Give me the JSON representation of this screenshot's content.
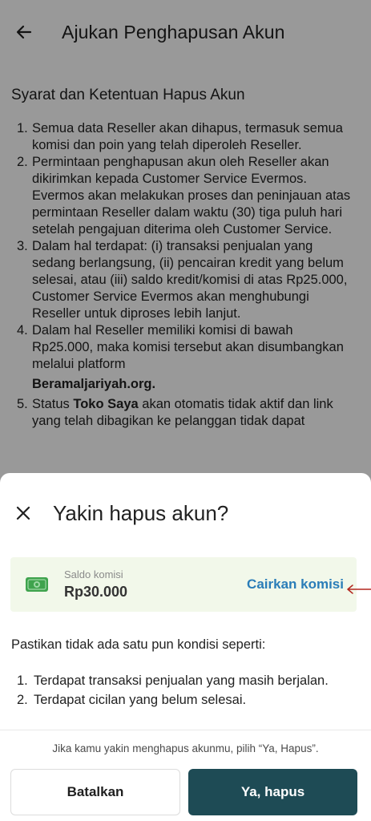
{
  "appbar": {
    "title": "Ajukan Penghapusan Akun"
  },
  "terms": {
    "heading": "Syarat dan Ketentuan Hapus Akun",
    "items": [
      {
        "num": "1.",
        "text": "Semua data Reseller akan dihapus, termasuk semua komisi dan poin yang telah diperoleh Reseller."
      },
      {
        "num": "2.",
        "text": "Permintaan penghapusan akun oleh Reseller akan dikirimkan kepada Customer Service Evermos. Evermos akan melakukan proses dan peninjauan atas permintaan Reseller dalam waktu (30) tiga puluh hari setelah pengajuan diterima oleh Customer Service."
      },
      {
        "num": "3.",
        "text": "Dalam hal terdapat: (i) transaksi penjualan yang sedang berlangsung, (ii) pencairan kredit yang belum selesai, atau (iii) saldo kredit/komisi di atas Rp25.000, Customer Service Evermos akan menghubungi Reseller untuk diproses lebih lanjut."
      },
      {
        "num": "4.",
        "text": "Dalam hal Reseller memiliki komisi di bawah Rp25.000, maka komisi tersebut akan disumbangkan melalui platform",
        "extra": "Beramaljariyah.org."
      },
      {
        "num": "5.",
        "text_pre": "Status ",
        "text_bold": "Toko Saya",
        "text_post": " akan otomatis tidak aktif dan link yang telah dibagikan ke pelanggan tidak dapat"
      }
    ]
  },
  "sheet": {
    "title": "Yakin hapus akun?",
    "saldo": {
      "label": "Saldo komisi",
      "value": "Rp30.000",
      "action": "Cairkan komisi"
    },
    "confirm_text": "Pastikan tidak ada satu pun kondisi seperti:",
    "conditions": [
      {
        "num": "1.",
        "text": "Terdapat transaksi penjualan yang masih berjalan."
      },
      {
        "num": "2.",
        "text": "Terdapat cicilan yang belum selesai."
      }
    ],
    "hint": "Jika kamu yakin menghapus akunmu, pilih “Ya, Hapus”.",
    "cancel_label": "Batalkan",
    "confirm_label": "Ya, hapus"
  },
  "colors": {
    "primary": "#1e4b55",
    "link": "#2a7db8",
    "card_bg": "#f2f8ea",
    "money": "#3fa34d",
    "arrow": "#b3261e"
  },
  "icons": {
    "back": "back-arrow-icon",
    "close": "close-icon",
    "money": "money-icon"
  }
}
